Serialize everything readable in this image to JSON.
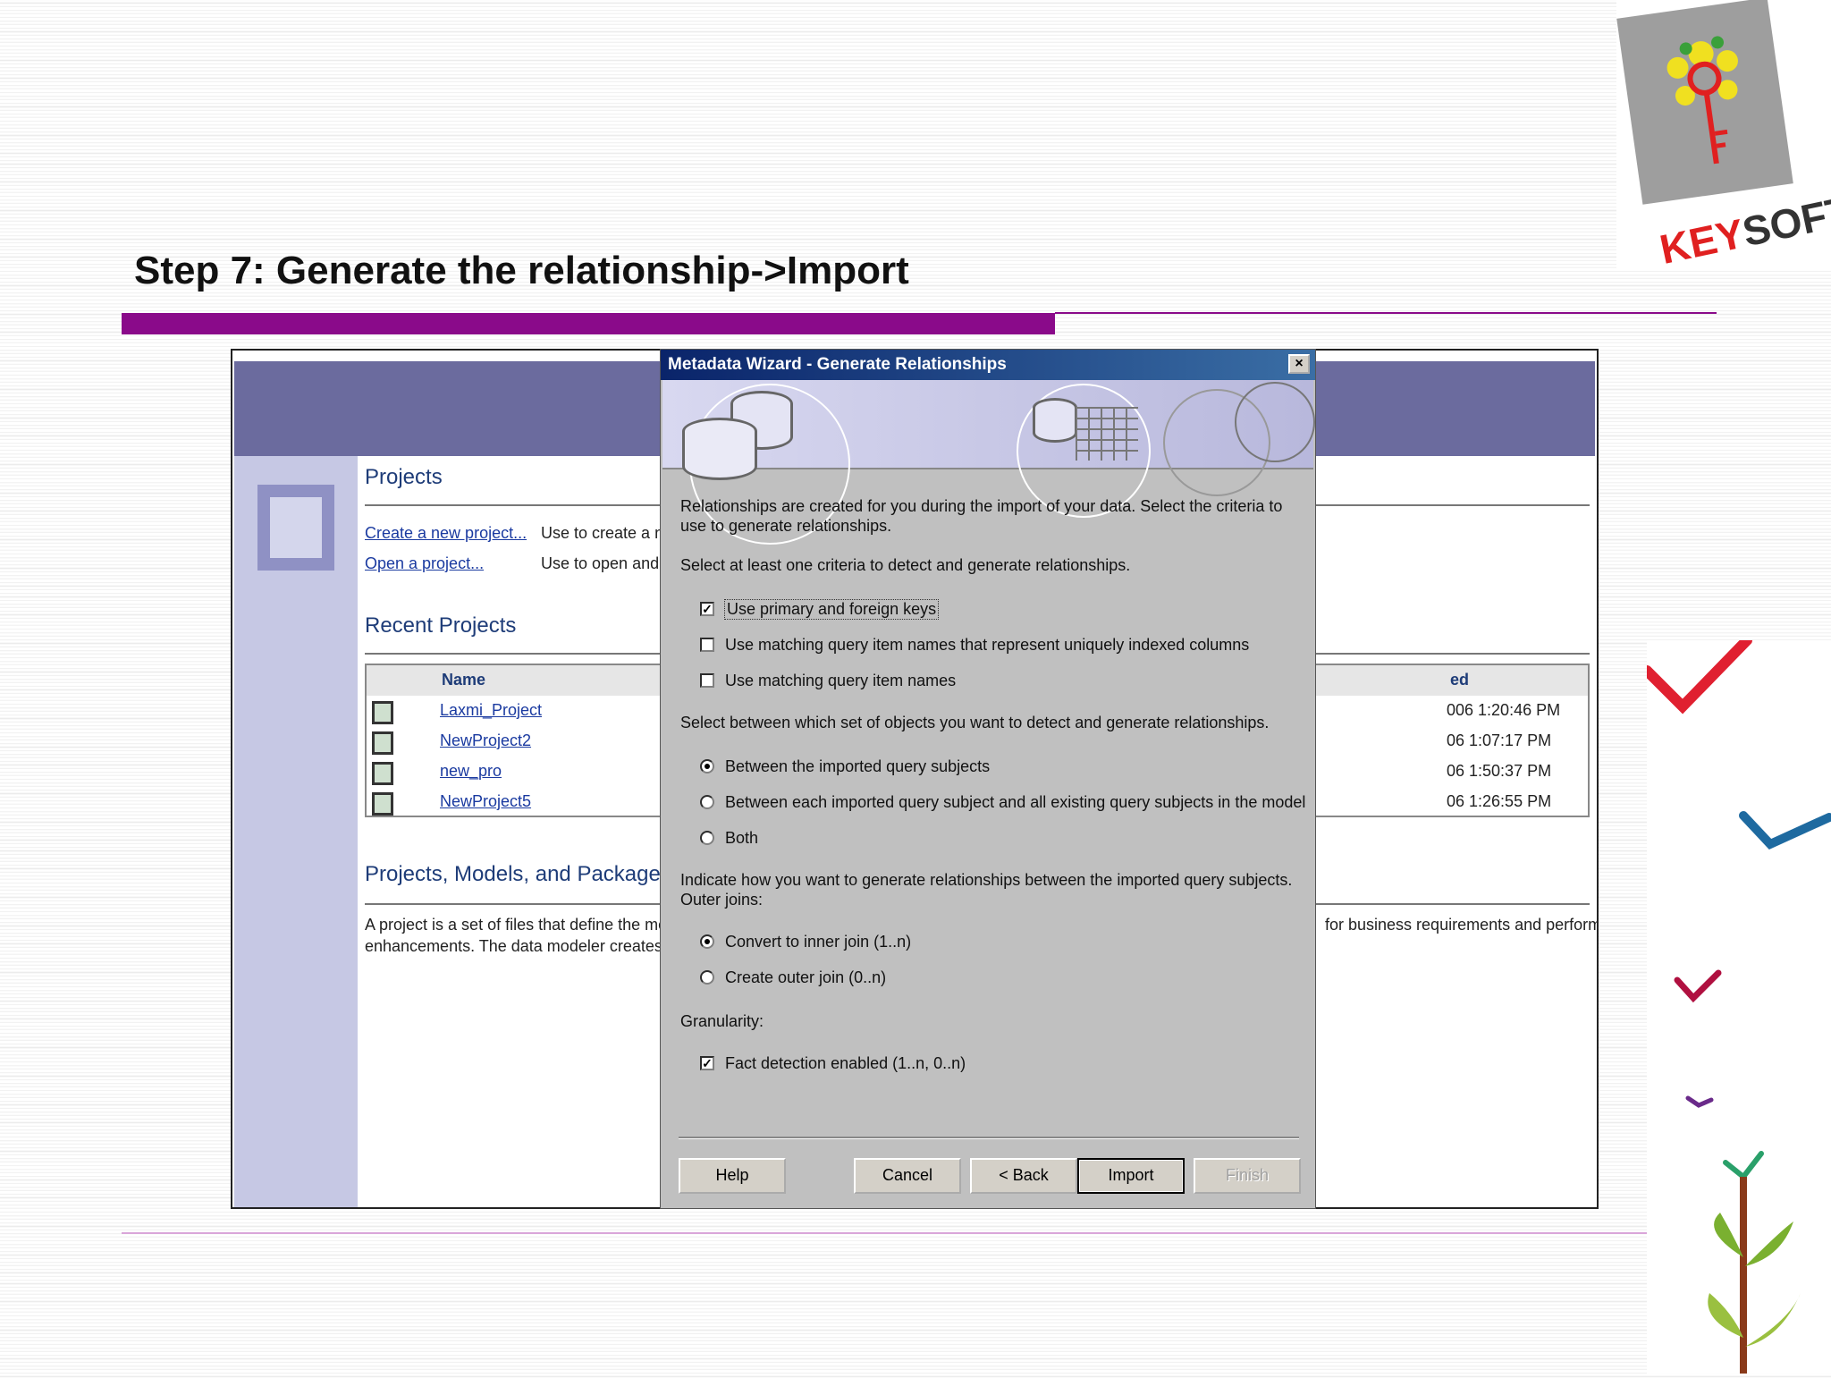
{
  "slide": {
    "title": "Step 7: Generate the relationship->Import"
  },
  "logo": {
    "text_red": "KEY",
    "text_dark": "SOFT"
  },
  "background_app": {
    "projects_heading": "Projects",
    "create_link": "Create a new project...",
    "create_desc": "Use to create a n",
    "open_link": "Open a project...",
    "open_desc": "Use to open and",
    "recent_heading": "Recent Projects",
    "table": {
      "col_name": "Name",
      "col_modified": "ed",
      "rows": [
        {
          "name": "Laxmi_Project",
          "modified": "006 1:20:46 PM"
        },
        {
          "name": "NewProject2",
          "modified": "06 1:07:17 PM"
        },
        {
          "name": "new_pro",
          "modified": "06 1:50:37 PM"
        },
        {
          "name": "NewProject5",
          "modified": "06 1:26:55 PM"
        }
      ]
    },
    "models_heading": "Projects, Models, and Package",
    "models_desc_1": "A project is a set of files that define the me",
    "models_desc_2": "enhancements. The data modeler creates p",
    "models_desc_right": "for business requirements and perform"
  },
  "dialog": {
    "title": "Metadata Wizard - Generate Relationships",
    "close_label": "×",
    "intro": "Relationships are created for you during the import of your data. Select the criteria to use to generate relationships.",
    "criteria_label": "Select at least one criteria to detect and generate relationships.",
    "criteria": [
      {
        "label": "Use primary and foreign keys",
        "checked": true
      },
      {
        "label": "Use matching query item names that represent uniquely indexed columns",
        "checked": false
      },
      {
        "label": "Use matching query item names",
        "checked": false
      }
    ],
    "objects_label": "Select between which set of objects you want to detect and generate relationships.",
    "objects": [
      {
        "label": "Between the imported query subjects",
        "selected": true
      },
      {
        "label": "Between each imported query subject and all existing query subjects in the model",
        "selected": false
      },
      {
        "label": "Both",
        "selected": false
      }
    ],
    "outer_label_1": "Indicate how you want to generate relationships between the imported query subjects.",
    "outer_label_2": "Outer joins:",
    "outer": [
      {
        "label": "Convert to inner join (1..n)",
        "selected": true
      },
      {
        "label": "Create outer join (0..n)",
        "selected": false
      }
    ],
    "granularity_label": "Granularity:",
    "granularity": {
      "label": "Fact detection enabled (1..n, 0..n)",
      "checked": true
    },
    "buttons": {
      "help": "Help",
      "cancel": "Cancel",
      "back": "< Back",
      "import": "Import",
      "finish": "Finish"
    }
  },
  "colors": {
    "accent_purple": "#8a0a8a",
    "dialog_title_start": "#0a246a",
    "dialog_title_end": "#3a6ea5",
    "dialog_face": "#c0c0c0"
  }
}
